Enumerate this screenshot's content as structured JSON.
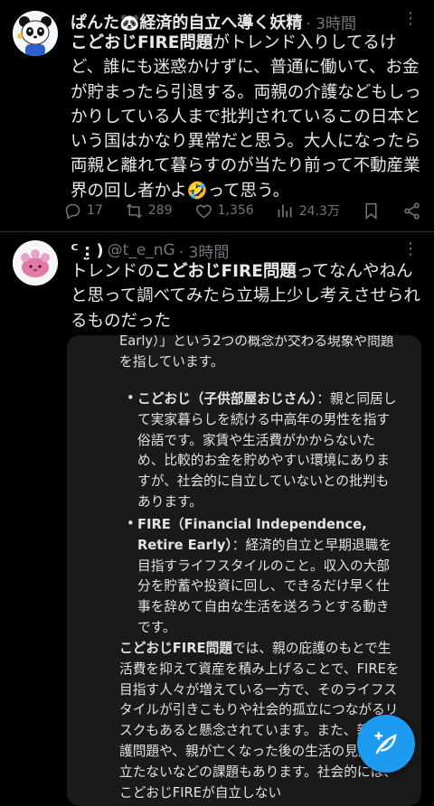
{
  "post1": {
    "display_name": "ぱんた🐼経済的自立へ導く妖精",
    "time": "· 3時間",
    "text_bold": "こどおじFIRE問題",
    "text_rest": "がトレンド入りしてるけど、誰にも迷惑かけずに、普通に働いて、お金が貯まったら引退する。両親の介護などもしっかりしている人まで批判されているこの日本という国はかなり異常だと思う。大人になったら両親と離れて暮らすのが当たり前って不動産業界の回し者かよ🤣って思う。",
    "replies": "17",
    "reposts": "289",
    "likes": "1,356",
    "views": "24.3万"
  },
  "post2": {
    "display_name": "ᑦ :̤̮ )",
    "handle": "@t_e_nG",
    "time": "· 3時間",
    "text_pre": "トレンドの",
    "text_bold": "こどおじFIRE問題",
    "text_post": "ってなんやねんと思って調べてみたら立場上少し考えさせられるものだった"
  },
  "card": {
    "intro_tail": "Early）」という2つの概念が交わる現象や問題を指しています。",
    "b1_term": "こどおじ（子供部屋おじさん）",
    "b1_text": "：親と同居して実家暮らしを続ける中高年の男性を指す俗語です。家賃や生活費がかからないため、比較的お金を貯めやすい環境にありますが、社会的に自立していないとの批判もあります。",
    "b2_term": "FIRE（Financial Independence, Retire Early）",
    "b2_text": "：経済的自立と早期退職を目指すライフスタイルのこと。収入の大部分を貯蓄や投資に回し、できるだけ早く仕事を辞めて自由な生活を送ろうとする動きです。",
    "p_bold": "こどおじFIRE問題",
    "p_text": "では、親の庇護のもとで生活費を抑えて資産を積み上げることで、FIREを目指す人々が増えている一方で、そのライフスタイルが引きこもりや社会的孤立につながるリスクもあると懸念されています。また、親の介護問題や、親が亡くなった後の生活の見通しが立たないなどの課題もあります。社会的には、こどおじFIREが自立しない"
  },
  "colors": {
    "accent": "#1d9bf0",
    "muted": "#71767b",
    "text": "#e7e9ea",
    "card_bg": "#1a1a1a"
  }
}
